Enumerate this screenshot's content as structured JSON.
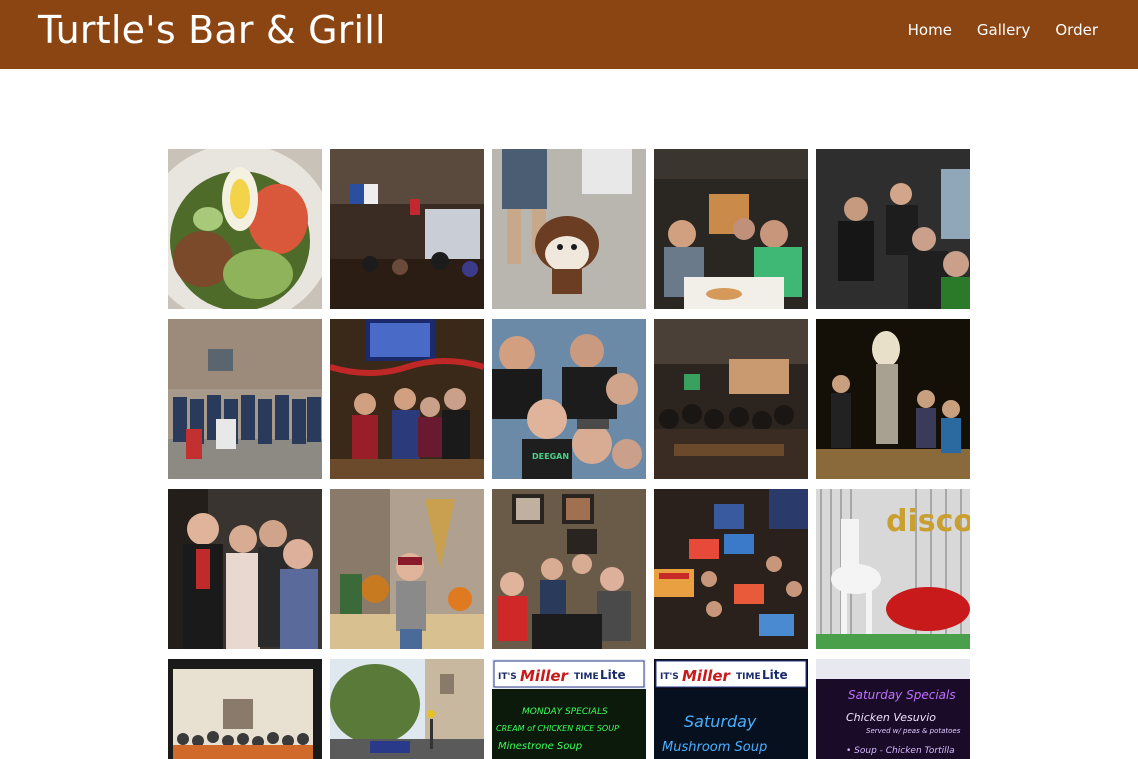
{
  "navbar": {
    "brand": "Turtle's Bar & Grill",
    "links": [
      "Home",
      "Gallery",
      "Order"
    ],
    "background": "#8b4513"
  },
  "gallery": {
    "photos": [
      {
        "subject": "salad-photo"
      },
      {
        "subject": "bar-interior-photo"
      },
      {
        "subject": "bulldog-photo"
      },
      {
        "subject": "diners-at-table-photo"
      },
      {
        "subject": "party-bus-photo"
      },
      {
        "subject": "group-outdoor-photo"
      },
      {
        "subject": "group-at-bar-photo"
      },
      {
        "subject": "selfie-group-photo"
      },
      {
        "subject": "crowded-bar-photo"
      },
      {
        "subject": "halloween-night-photo"
      },
      {
        "subject": "costume-girls-photo"
      },
      {
        "subject": "fall-display-boy-photo"
      },
      {
        "subject": "kids-at-table-photo"
      },
      {
        "subject": "paint-night-photo"
      },
      {
        "subject": "disco-horse-photo"
      },
      {
        "subject": "framed-group-photo"
      },
      {
        "subject": "street-view-photo"
      },
      {
        "subject": "chalkboard-soup-photo"
      },
      {
        "subject": "chalkboard-mushroom-photo"
      },
      {
        "subject": "chalkboard-specials-photo"
      }
    ],
    "signs": {
      "miller_text": "Miller",
      "its_text": "IT'S",
      "time_text": "TIME",
      "lite_text": "Lite",
      "board1_line1": "MONDAY SPECIALS",
      "board1_line2": "CREAM of CHICKEN RICE SOUP",
      "board1_line3": "Minestrone Soup",
      "board2_line1": "Saturday",
      "board2_line2": "Mushroom Soup",
      "board3_line1": "Saturday Specials",
      "board3_line2": "Chicken Vesuvio",
      "board3_line3": "Served w/ peas & potatoes",
      "board3_line4": "• Soup - Chicken Tortilla",
      "disco_text": "disco"
    }
  }
}
